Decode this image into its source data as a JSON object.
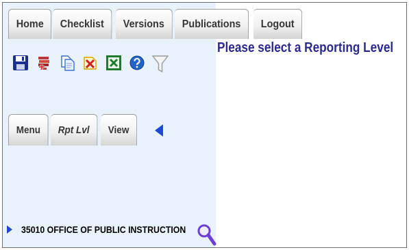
{
  "top_tabs": [
    "Home",
    "Checklist",
    "Versions",
    "Publications",
    "Logout"
  ],
  "toolbar_icons": [
    "save-icon",
    "books-add-icon",
    "copy-icon",
    "delete-icon",
    "excel-icon",
    "help-icon",
    "filter-icon"
  ],
  "sub_tabs": [
    "Menu",
    "Rpt Lvl",
    "View"
  ],
  "tree": {
    "item_label": "35010 OFFICE OF PUBLIC INSTRUCTION"
  },
  "main": {
    "message": "Please select a Reporting Level"
  },
  "colors": {
    "left_pane_bg": "#e9f2fb",
    "accent_blue": "#1d47d8",
    "message_text": "#2a2a8f"
  }
}
